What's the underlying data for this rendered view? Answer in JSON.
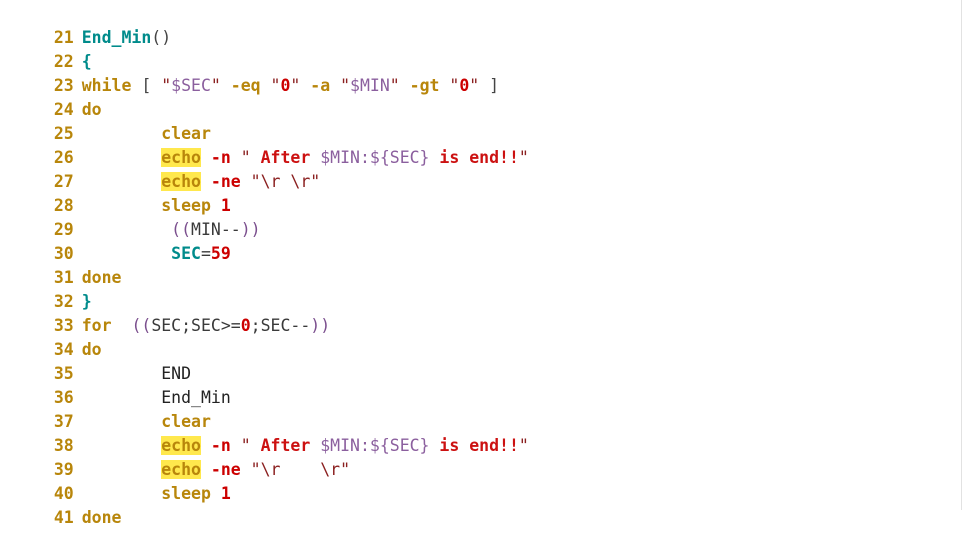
{
  "editor": {
    "language": "bash",
    "background_color": "#ffffff",
    "highlight_color": "#ffe84d",
    "first_line_number": 21,
    "last_line_number": 41
  },
  "palette": {
    "lineno": "#b8860b",
    "keyword": "#b8860b",
    "function": "#008b8b",
    "option": "#cc0000",
    "number": "#cc0000",
    "quote": "#8b2020",
    "string": "#cc1111",
    "variable": "#8b5f9e",
    "paren": "#7b4f8e",
    "plain": "#3a3a3a",
    "highlight": "#ffe84d"
  },
  "lines": [
    {
      "number": "21",
      "text": "End_Min()"
    },
    {
      "number": "22",
      "text": "{"
    },
    {
      "number": "23",
      "text": "while [ \"$SEC\" -eq \"0\" -a \"$MIN\" -gt \"0\" ]"
    },
    {
      "number": "24",
      "text": "do"
    },
    {
      "number": "25",
      "text": "        clear"
    },
    {
      "number": "26",
      "text": "        echo -n \" After $MIN:${SEC} is end!!\""
    },
    {
      "number": "27",
      "text": "        echo -ne \"\\r \\r\""
    },
    {
      "number": "28",
      "text": "        sleep 1"
    },
    {
      "number": "29",
      "text": "        ((MIN--))"
    },
    {
      "number": "30",
      "text": "        SEC=59"
    },
    {
      "number": "31",
      "text": "done"
    },
    {
      "number": "32",
      "text": "}"
    },
    {
      "number": "33",
      "text": "for ((SEC;SEC>=0;SEC--))"
    },
    {
      "number": "34",
      "text": "do"
    },
    {
      "number": "35",
      "text": "        END"
    },
    {
      "number": "36",
      "text": "        End_Min"
    },
    {
      "number": "37",
      "text": "        clear"
    },
    {
      "number": "38",
      "text": "        echo -n \" After $MIN:${SEC} is end!!\""
    },
    {
      "number": "39",
      "text": "        echo -ne \"\\r    \\r\""
    },
    {
      "number": "40",
      "text": "        sleep 1"
    },
    {
      "number": "41",
      "text": "done"
    }
  ],
  "tokens": {
    "l21": {
      "name": "End_Min",
      "parens": "()"
    },
    "l22": {
      "brace": "{"
    },
    "l23": {
      "while": "while",
      "lb": " [ ",
      "q": "\"",
      "sec": "$SEC",
      "eq": "-eq",
      "zero": "0",
      "a": "-a",
      "min": "$MIN",
      "gt": "-gt",
      "rb": " ]"
    },
    "l24": {
      "do": "do"
    },
    "l25": {
      "clear": "clear"
    },
    "l26": {
      "echo": "echo",
      "opt": "-n",
      "q": "\"",
      "str_a": " After ",
      "var": "$MIN:${SEC}",
      "str_b": " is end!!"
    },
    "l27": {
      "echo": "echo",
      "opt": "-ne",
      "q": "\"",
      "esc1": "\\r",
      "gap": " ",
      "esc2": "\\r"
    },
    "l28": {
      "sleep": "sleep",
      "num": "1"
    },
    "l29": {
      "open": "((",
      "expr": "MIN--",
      "close": "))"
    },
    "l30": {
      "var": "SEC",
      "eq": "=",
      "num": "59"
    },
    "l31": {
      "done": "done"
    },
    "l32": {
      "brace": "}"
    },
    "l33": {
      "for": "for",
      "open": "((",
      "e1": "SEC;SEC>=",
      "num": "0",
      "e2": ";SEC--",
      "close": "))"
    },
    "l34": {
      "do": "do"
    },
    "l35": {
      "call": "END"
    },
    "l36": {
      "call": "End_Min"
    },
    "l37": {
      "clear": "clear"
    },
    "l38": {
      "echo": "echo",
      "opt": "-n",
      "q": "\"",
      "str_a": " After ",
      "var": "$MIN:${SEC}",
      "str_b": " is end!!"
    },
    "l39": {
      "echo": "echo",
      "opt": "-ne",
      "q": "\"",
      "esc1": "\\r",
      "gap": "    ",
      "esc2": "\\r"
    },
    "l40": {
      "sleep": "sleep",
      "num": "1"
    },
    "l41": {
      "done": "done"
    }
  }
}
